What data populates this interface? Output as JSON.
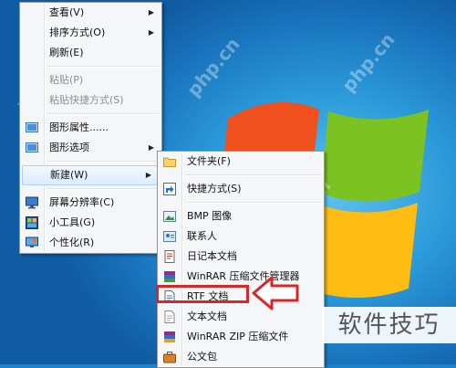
{
  "context_menu": {
    "items": [
      {
        "label": "查看(V)",
        "submenu": true
      },
      {
        "label": "排序方式(O)",
        "submenu": true
      },
      {
        "label": "刷新(E)"
      },
      {
        "label": "粘贴(P)",
        "disabled": true
      },
      {
        "label": "粘贴快捷方式(S)",
        "disabled": true
      },
      {
        "label": "图形属性......",
        "icon": "graphics-properties-icon"
      },
      {
        "label": "图形选项",
        "icon": "graphics-options-icon",
        "submenu": true
      },
      {
        "label": "新建(W)",
        "submenu": true,
        "highlighted": true
      },
      {
        "label": "屏幕分辨率(C)",
        "icon": "screen-resolution-icon"
      },
      {
        "label": "小工具(G)",
        "icon": "gadgets-icon"
      },
      {
        "label": "个性化(R)",
        "icon": "personalize-icon"
      }
    ]
  },
  "new_submenu": {
    "items": [
      {
        "label": "文件夹(F)",
        "icon": "folder-icon"
      },
      {
        "label": "快捷方式(S)",
        "icon": "shortcut-icon"
      },
      {
        "label": "BMP 图像",
        "icon": "bmp-image-icon"
      },
      {
        "label": "联系人",
        "icon": "contact-icon"
      },
      {
        "label": "日记本文档",
        "icon": "journal-document-icon"
      },
      {
        "label": "WinRAR 压缩文件管理器",
        "icon": "winrar-archive-icon"
      },
      {
        "label": "RTF 文档",
        "icon": "rtf-document-icon"
      },
      {
        "label": "文本文档",
        "icon": "text-document-icon",
        "highlighted": true
      },
      {
        "label": "WinRAR ZIP 压缩文件",
        "icon": "winrar-zip-icon"
      },
      {
        "label": "公文包",
        "icon": "briefcase-icon"
      }
    ]
  },
  "watermark": {
    "text": "php.cn"
  },
  "badge": {
    "text": "软件技巧"
  },
  "colors": {
    "highlight_box": "#d8262b",
    "menu_bg": "#f5f6f7",
    "desktop": "#1c83c9"
  }
}
